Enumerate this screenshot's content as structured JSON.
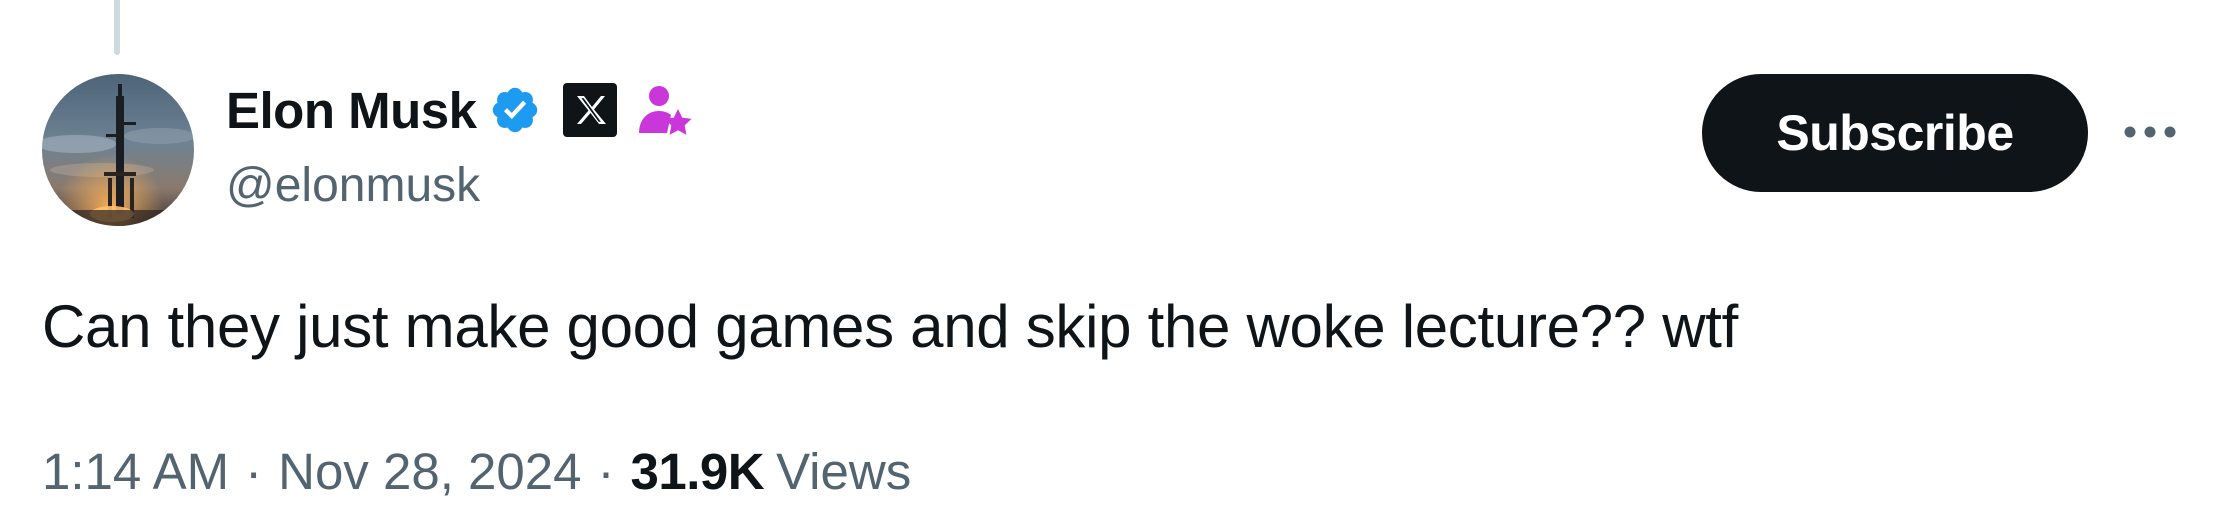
{
  "author": {
    "display_name": "Elon Musk",
    "handle": "@elonmusk",
    "verified_icon": "verified-badge-icon",
    "org_badge_icon": "x-logo-icon",
    "affiliate_icon": "person-star-icon"
  },
  "actions": {
    "subscribe_label": "Subscribe",
    "more_icon": "more-icon"
  },
  "tweet": {
    "text": "Can they just make good games and skip the woke lecture?? wtf"
  },
  "meta": {
    "time": "1:14 AM",
    "separator": "·",
    "date": "Nov 28, 2024",
    "views_count": "31.9K",
    "views_label": "Views"
  },
  "colors": {
    "text_primary": "#0f1419",
    "text_secondary": "#536471",
    "verified_blue": "#1d9bf0",
    "affiliate_magenta": "#c936d9",
    "button_dark": "#0f1419"
  }
}
